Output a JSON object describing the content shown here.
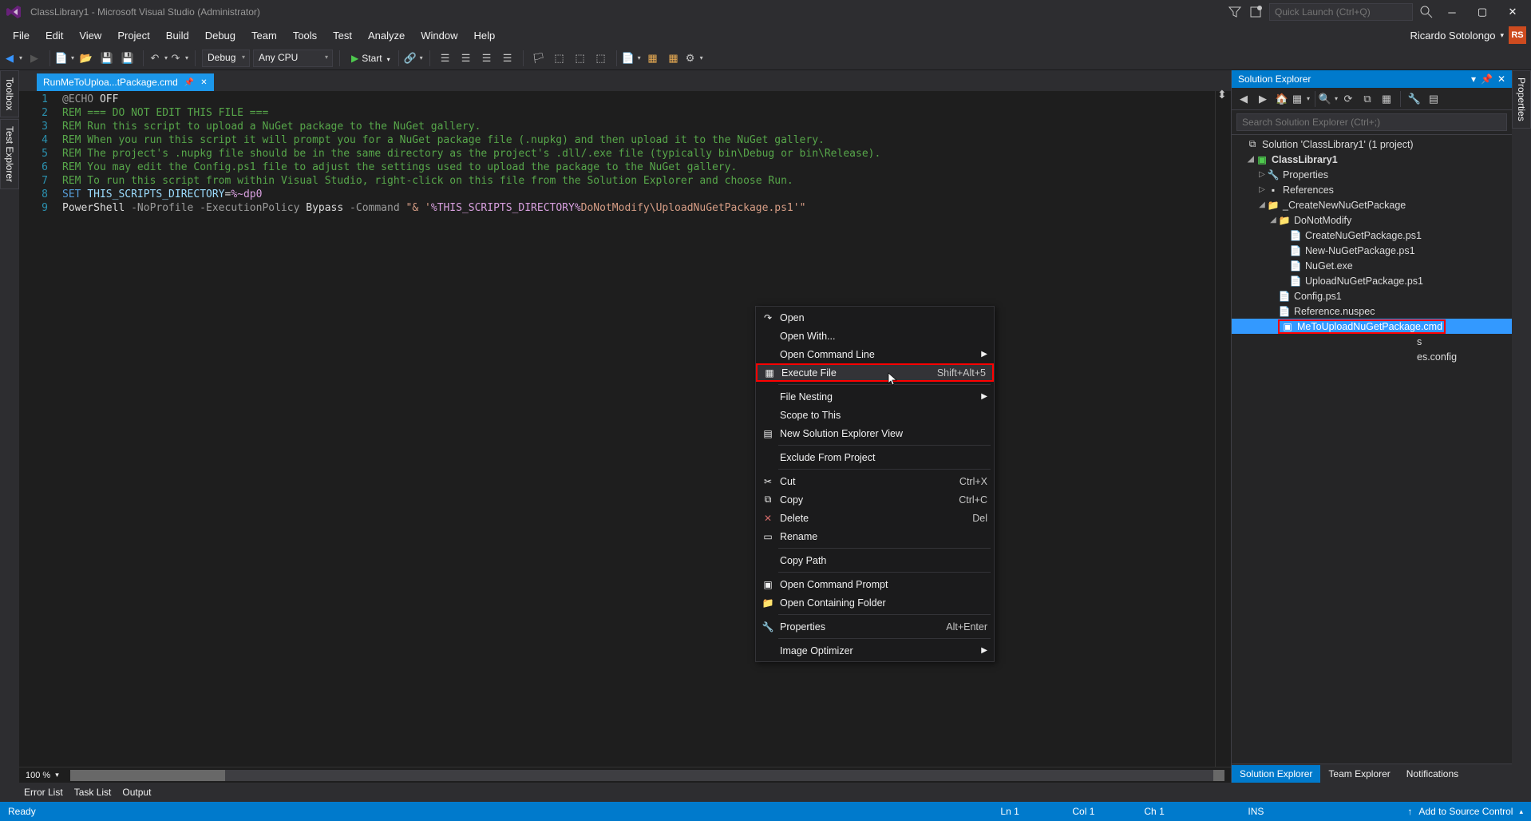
{
  "titlebar": {
    "title": "ClassLibrary1 - Microsoft Visual Studio  (Administrator)",
    "quick_launch_placeholder": "Quick Launch (Ctrl+Q)"
  },
  "menubar": {
    "items": [
      "File",
      "Edit",
      "View",
      "Project",
      "Build",
      "Debug",
      "Team",
      "Tools",
      "Test",
      "Analyze",
      "Window",
      "Help"
    ],
    "user": "Ricardo Sotolongo",
    "badge": "RS"
  },
  "toolbar": {
    "config": "Debug",
    "platform": "Any CPU",
    "start_label": "Start"
  },
  "left_dock": [
    "Toolbox",
    "Test Explorer"
  ],
  "right_dock": [
    "Properties"
  ],
  "editor": {
    "tab_label": "RunMeToUploa...tPackage.cmd",
    "zoom": "100 %",
    "lines": [
      [
        {
          "c": "gray",
          "t": "@ECHO"
        },
        {
          "c": "white",
          "t": " OFF"
        }
      ],
      [
        {
          "c": "green",
          "t": "REM"
        },
        {
          "c": "green",
          "t": " === DO NOT EDIT THIS FILE ==="
        }
      ],
      [
        {
          "c": "green",
          "t": "REM"
        },
        {
          "c": "green",
          "t": " Run this script to upload a NuGet package to the NuGet gallery."
        }
      ],
      [
        {
          "c": "green",
          "t": "REM"
        },
        {
          "c": "green",
          "t": " When you run this script it will prompt you for a NuGet package file (.nupkg) and then upload it to the NuGet gallery."
        }
      ],
      [
        {
          "c": "green",
          "t": "REM"
        },
        {
          "c": "green",
          "t": " The project's .nupkg file should be in the same directory as the project's .dll/.exe file (typically bin\\Debug or bin\\Release)."
        }
      ],
      [
        {
          "c": "green",
          "t": "REM"
        },
        {
          "c": "green",
          "t": " You may edit the Config.ps1 file to adjust the settings used to upload the package to the NuGet gallery."
        }
      ],
      [
        {
          "c": "green",
          "t": "REM"
        },
        {
          "c": "green",
          "t": " To run this script from within Visual Studio, right-click on this file from the Solution Explorer and choose Run."
        }
      ],
      [
        {
          "c": "blue",
          "t": "SET"
        },
        {
          "c": "white",
          "t": " "
        },
        {
          "c": "ltblue",
          "t": "THIS_SCRIPTS_DIRECTORY"
        },
        {
          "c": "white",
          "t": "="
        },
        {
          "c": "mag",
          "t": "%~dp0"
        }
      ],
      [
        {
          "c": "white",
          "t": "PowerShell "
        },
        {
          "c": "gray",
          "t": "-NoProfile -ExecutionPolicy"
        },
        {
          "c": "white",
          "t": " Bypass "
        },
        {
          "c": "gray",
          "t": "-Command"
        },
        {
          "c": "white",
          "t": " "
        },
        {
          "c": "orange",
          "t": "\"& '"
        },
        {
          "c": "mag",
          "t": "%THIS_SCRIPTS_DIRECTORY%"
        },
        {
          "c": "orange",
          "t": "DoNotModify\\UploadNuGetPackage.ps1'\""
        }
      ]
    ]
  },
  "solution_explorer": {
    "title": "Solution Explorer",
    "search_placeholder": "Search Solution Explorer (Ctrl+;)",
    "root": "Solution 'ClassLibrary1' (1 project)",
    "project": "ClassLibrary1",
    "properties": "Properties",
    "references": "References",
    "folder1": "_CreateNewNuGetPackage",
    "folder2": "DoNotModify",
    "files_under_dnm": [
      "CreateNuGetPackage.ps1",
      "New-NuGetPackage.ps1",
      "NuGet.exe",
      "UploadNuGetPackage.ps1"
    ],
    "config": "Config.ps1",
    "reference": "Reference.nuspec",
    "runme": "MeToUploadNuGetPackage.cmd",
    "hidden1": "s",
    "hidden2": "es.config",
    "bottom_tabs": [
      "Solution Explorer",
      "Team Explorer",
      "Notifications"
    ]
  },
  "context_menu": {
    "items": [
      {
        "icon": "↷",
        "label": "Open",
        "shortcut": ""
      },
      {
        "icon": "",
        "label": "Open With...",
        "shortcut": ""
      },
      {
        "icon": "",
        "label": "Open Command Line",
        "shortcut": "",
        "sub": true
      },
      {
        "icon": "▦",
        "label": "Execute File",
        "shortcut": "Shift+Alt+5",
        "hl": true
      },
      {
        "sep": true
      },
      {
        "icon": "",
        "label": "File Nesting",
        "shortcut": "",
        "sub": true
      },
      {
        "icon": "",
        "label": "Scope to This",
        "shortcut": ""
      },
      {
        "icon": "▤",
        "label": "New Solution Explorer View",
        "shortcut": ""
      },
      {
        "sep": true
      },
      {
        "icon": "",
        "label": "Exclude From Project",
        "shortcut": ""
      },
      {
        "sep": true
      },
      {
        "icon": "✂",
        "label": "Cut",
        "shortcut": "Ctrl+X"
      },
      {
        "icon": "⧉",
        "label": "Copy",
        "shortcut": "Ctrl+C"
      },
      {
        "icon": "✕",
        "label": "Delete",
        "shortcut": "Del",
        "iconcolor": "#d16969"
      },
      {
        "icon": "▭",
        "label": "Rename",
        "shortcut": ""
      },
      {
        "sep": true
      },
      {
        "icon": "",
        "label": "Copy Path",
        "shortcut": ""
      },
      {
        "sep": true
      },
      {
        "icon": "▣",
        "label": "Open Command Prompt",
        "shortcut": ""
      },
      {
        "icon": "📁",
        "label": "Open Containing Folder",
        "shortcut": ""
      },
      {
        "sep": true
      },
      {
        "icon": "🔧",
        "label": "Properties",
        "shortcut": "Alt+Enter"
      },
      {
        "sep": true
      },
      {
        "icon": "",
        "label": "Image Optimizer",
        "shortcut": "",
        "sub": true
      }
    ]
  },
  "bottom_tabs": [
    "Error List",
    "Task List",
    "Output"
  ],
  "statusbar": {
    "ready": "Ready",
    "ln": "Ln 1",
    "col": "Col 1",
    "ch": "Ch 1",
    "ins": "INS",
    "source_control": "Add to Source Control"
  }
}
